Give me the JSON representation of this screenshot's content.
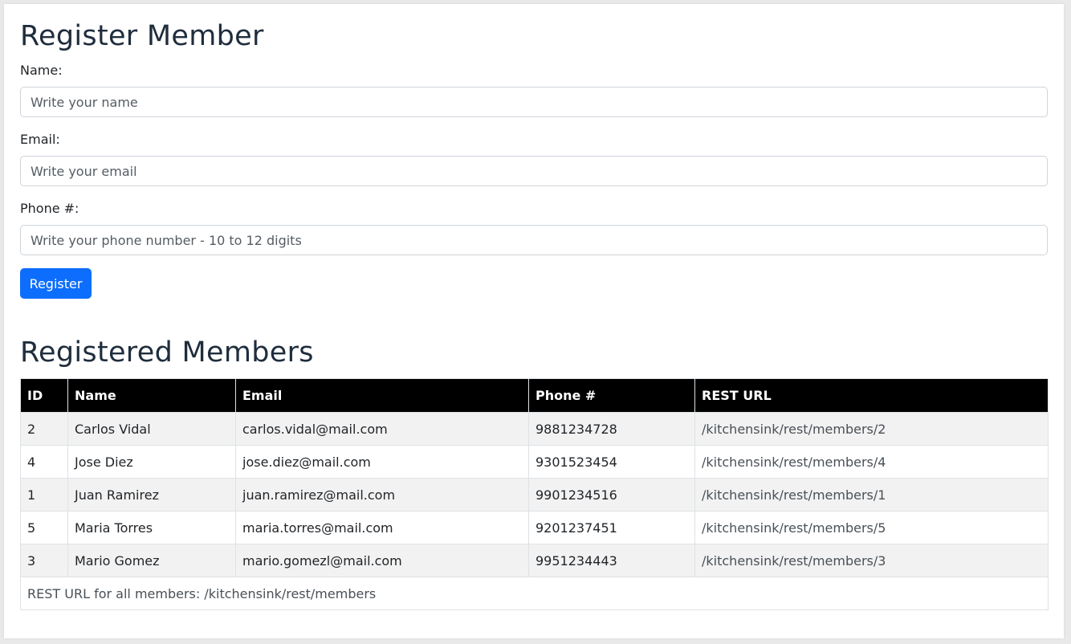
{
  "form": {
    "title": "Register Member",
    "name_label": "Name:",
    "name_placeholder": "Write your name",
    "name_value": "",
    "email_label": "Email:",
    "email_placeholder": "Write your email",
    "email_value": "",
    "phone_label": "Phone #:",
    "phone_placeholder": "Write your phone number - 10 to 12 digits",
    "phone_value": "",
    "register_label": "Register"
  },
  "members": {
    "title": "Registered Members",
    "headers": [
      "ID",
      "Name",
      "Email",
      "Phone #",
      "REST URL"
    ],
    "rows": [
      {
        "id": "2",
        "name": "Carlos Vidal",
        "email": "carlos.vidal@mail.com",
        "phone": "9881234728",
        "url": "/kitchensink/rest/members/2"
      },
      {
        "id": "4",
        "name": "Jose Diez",
        "email": "jose.diez@mail.com",
        "phone": "9301523454",
        "url": "/kitchensink/rest/members/4"
      },
      {
        "id": "1",
        "name": "Juan Ramirez",
        "email": "juan.ramirez@mail.com",
        "phone": "9901234516",
        "url": "/kitchensink/rest/members/1"
      },
      {
        "id": "5",
        "name": "Maria Torres",
        "email": "maria.torres@mail.com",
        "phone": "9201237451",
        "url": "/kitchensink/rest/members/5"
      },
      {
        "id": "3",
        "name": "Mario Gomez",
        "email": "mario.gomezl@mail.com",
        "phone": "9951234443",
        "url": "/kitchensink/rest/members/3"
      }
    ],
    "footer_label": "REST URL for all members:",
    "footer_url": "/kitchensink/rest/members"
  },
  "colors": {
    "primary_button": "#0d6efd",
    "table_header_bg": "#000000",
    "striped_row_bg": "#f2f2f2"
  }
}
